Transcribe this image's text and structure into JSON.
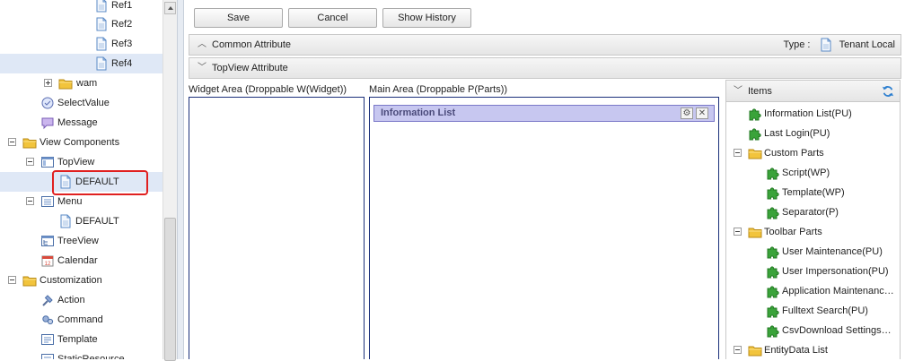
{
  "tree": {
    "items": [
      {
        "label": "Ref1",
        "icon": "document-icon"
      },
      {
        "label": "Ref2",
        "icon": "document-icon"
      },
      {
        "label": "Ref3",
        "icon": "document-icon"
      },
      {
        "label": "Ref4",
        "icon": "document-icon"
      },
      {
        "label": "wam",
        "icon": "folder-icon"
      },
      {
        "label": "SelectValue",
        "icon": "selectvalue-icon"
      },
      {
        "label": "Message",
        "icon": "message-icon"
      },
      {
        "label": "View Components",
        "icon": "folder-icon"
      },
      {
        "label": "TopView",
        "icon": "topview-icon"
      },
      {
        "label": "DEFAULT",
        "icon": "document-icon"
      },
      {
        "label": "Menu",
        "icon": "menu-icon"
      },
      {
        "label": "DEFAULT",
        "icon": "document-icon"
      },
      {
        "label": "TreeView",
        "icon": "treeview-icon"
      },
      {
        "label": "Calendar",
        "icon": "calendar-icon"
      },
      {
        "label": "Customization",
        "icon": "folder-icon"
      },
      {
        "label": "Action",
        "icon": "action-icon"
      },
      {
        "label": "Command",
        "icon": "command-icon"
      },
      {
        "label": "Template",
        "icon": "template-icon"
      },
      {
        "label": "StaticResource",
        "icon": "resource-icon"
      }
    ],
    "calendar_icon_text": "12"
  },
  "toolbar": {
    "save_label": "Save",
    "cancel_label": "Cancel",
    "history_label": "Show History"
  },
  "common": {
    "title": "Common Attribute",
    "type_label": "Type :",
    "type_value": "Tenant Local"
  },
  "topview": {
    "title": "TopView Attribute",
    "widget_area_label": "Widget Area (Droppable W(Widget))",
    "main_area_label": "Main Area (Droppable P(Parts))",
    "parts": [
      {
        "title": "Information List"
      }
    ]
  },
  "items_panel": {
    "title": "Items",
    "items": [
      {
        "label": "Information List(PU)",
        "icon": "puzzle-icon"
      },
      {
        "label": "Last Login(PU)",
        "icon": "puzzle-icon"
      },
      {
        "label": "Custom Parts",
        "icon": "folder-icon"
      },
      {
        "label": "Script(WP)",
        "icon": "puzzle-icon"
      },
      {
        "label": "Template(WP)",
        "icon": "puzzle-icon"
      },
      {
        "label": "Separator(P)",
        "icon": "puzzle-icon"
      },
      {
        "label": "Toolbar Parts",
        "icon": "folder-icon"
      },
      {
        "label": "User Maintenance(PU)",
        "icon": "puzzle-icon"
      },
      {
        "label": "User Impersonation(PU)",
        "icon": "puzzle-icon"
      },
      {
        "label": "Application Maintenanc…",
        "icon": "puzzle-icon"
      },
      {
        "label": "Fulltext Search(PU)",
        "icon": "puzzle-icon"
      },
      {
        "label": "CsvDownload Settings…",
        "icon": "puzzle-icon"
      },
      {
        "label": "EntityData List",
        "icon": "folder-icon"
      }
    ]
  },
  "colors": {
    "selection": "#dfe8f6",
    "highlight": "#e02020",
    "part_header": "#c7c7f0",
    "drop_border": "#1a2f7a",
    "puzzle": "#3aa33a",
    "folder": "#f2c43c"
  }
}
